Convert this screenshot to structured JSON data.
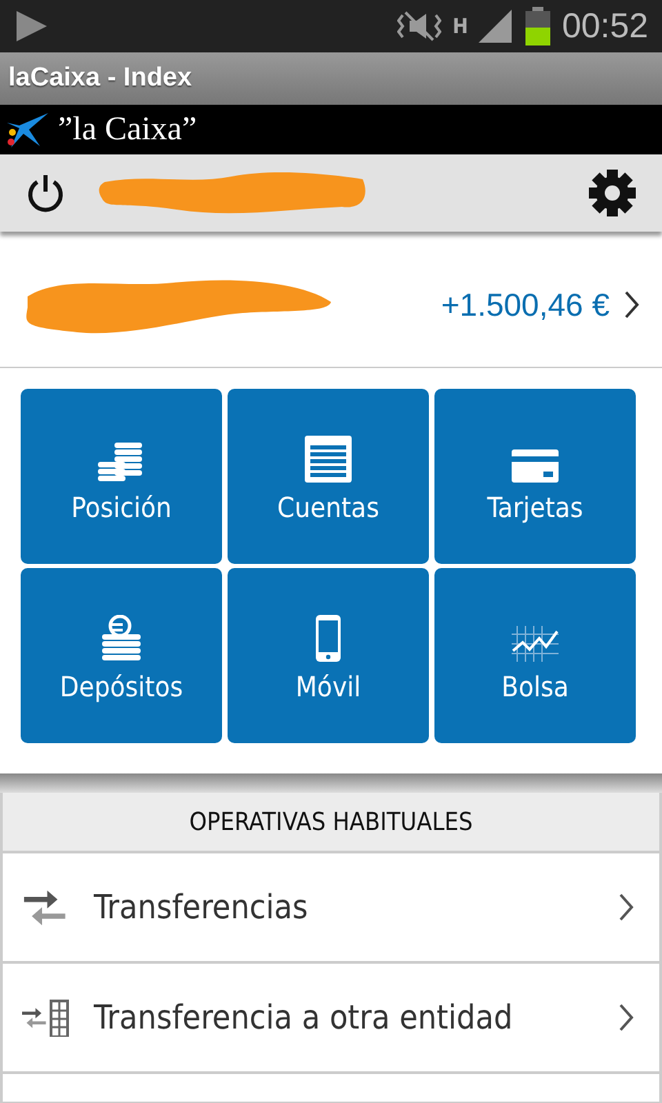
{
  "status_bar": {
    "network": "H",
    "time": "00:52"
  },
  "window": {
    "title": "laCaixa - Index"
  },
  "brand": {
    "name": "”la Caixa”"
  },
  "balance": {
    "amount": "+1.500,46 €"
  },
  "tiles": [
    {
      "label": "Posición"
    },
    {
      "label": "Cuentas"
    },
    {
      "label": "Tarjetas"
    },
    {
      "label": "Depósitos"
    },
    {
      "label": "Móvil"
    },
    {
      "label": "Bolsa"
    }
  ],
  "section": {
    "title": "OPERATIVAS HABITUALES"
  },
  "operations": [
    {
      "label": "Transferencias"
    },
    {
      "label": "Transferencia a otra entidad"
    }
  ]
}
